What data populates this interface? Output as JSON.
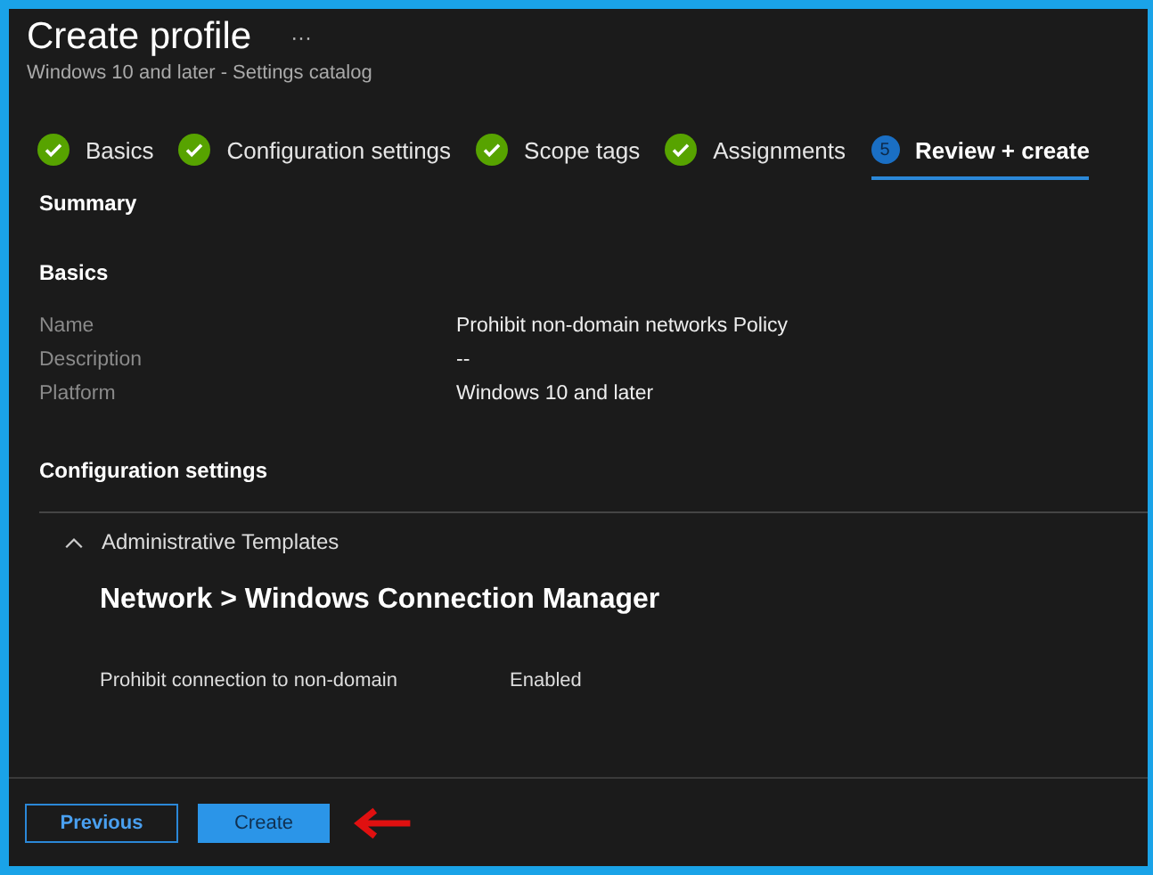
{
  "header": {
    "title": "Create profile",
    "more": "···",
    "subtitle": "Windows 10 and later - Settings catalog"
  },
  "steps": [
    {
      "label": "Basics",
      "kind": "done",
      "selected": false
    },
    {
      "label": "Configuration settings",
      "kind": "done",
      "selected": false
    },
    {
      "label": "Scope tags",
      "kind": "done",
      "selected": false
    },
    {
      "label": "Assignments",
      "kind": "done",
      "selected": false
    },
    {
      "label": "Review + create",
      "kind": "numbered",
      "number": "5",
      "selected": true
    }
  ],
  "summary": {
    "title": "Summary",
    "basics_heading": "Basics",
    "fields": [
      {
        "label": "Name",
        "value": "Prohibit non-domain networks Policy"
      },
      {
        "label": "Description",
        "value": "--"
      },
      {
        "label": "Platform",
        "value": "Windows 10 and later"
      }
    ],
    "config_heading": "Configuration settings",
    "section": {
      "title": "Administrative Templates",
      "expanded": true,
      "category": "Network > Windows Connection Manager",
      "settings": [
        {
          "name": "Prohibit connection to non-domain",
          "value": "Enabled"
        }
      ]
    }
  },
  "footer": {
    "buttons": [
      {
        "label": "Previous",
        "kind": "secondary"
      },
      {
        "label": "Create",
        "kind": "primary"
      }
    ]
  }
}
